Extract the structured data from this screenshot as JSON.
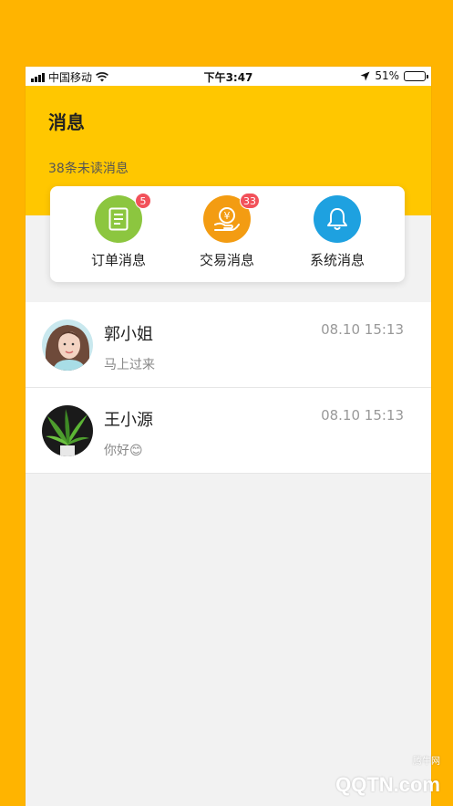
{
  "status_bar": {
    "carrier": "中国移动",
    "time": "下午3:47",
    "battery": "51%",
    "battery_level": 0.51
  },
  "header": {
    "title": "消息",
    "subtitle": "38条未读消息"
  },
  "categories": [
    {
      "label": "订单消息",
      "badge": "5",
      "color": "#8CC63F",
      "icon": "document-icon"
    },
    {
      "label": "交易消息",
      "badge": "33",
      "color": "#F39C12",
      "icon": "yuan-hand-icon"
    },
    {
      "label": "系统消息",
      "badge": "",
      "color": "#1EA1E0",
      "icon": "bell-icon"
    }
  ],
  "messages": [
    {
      "name": "郭小姐",
      "time": "08.10 15:13",
      "text": "马上过来"
    },
    {
      "name": "王小源",
      "time": "08.10 15:13",
      "text": "你好😊"
    }
  ],
  "watermark": {
    "text": "QQTN.com",
    "small": "腾牛网"
  }
}
